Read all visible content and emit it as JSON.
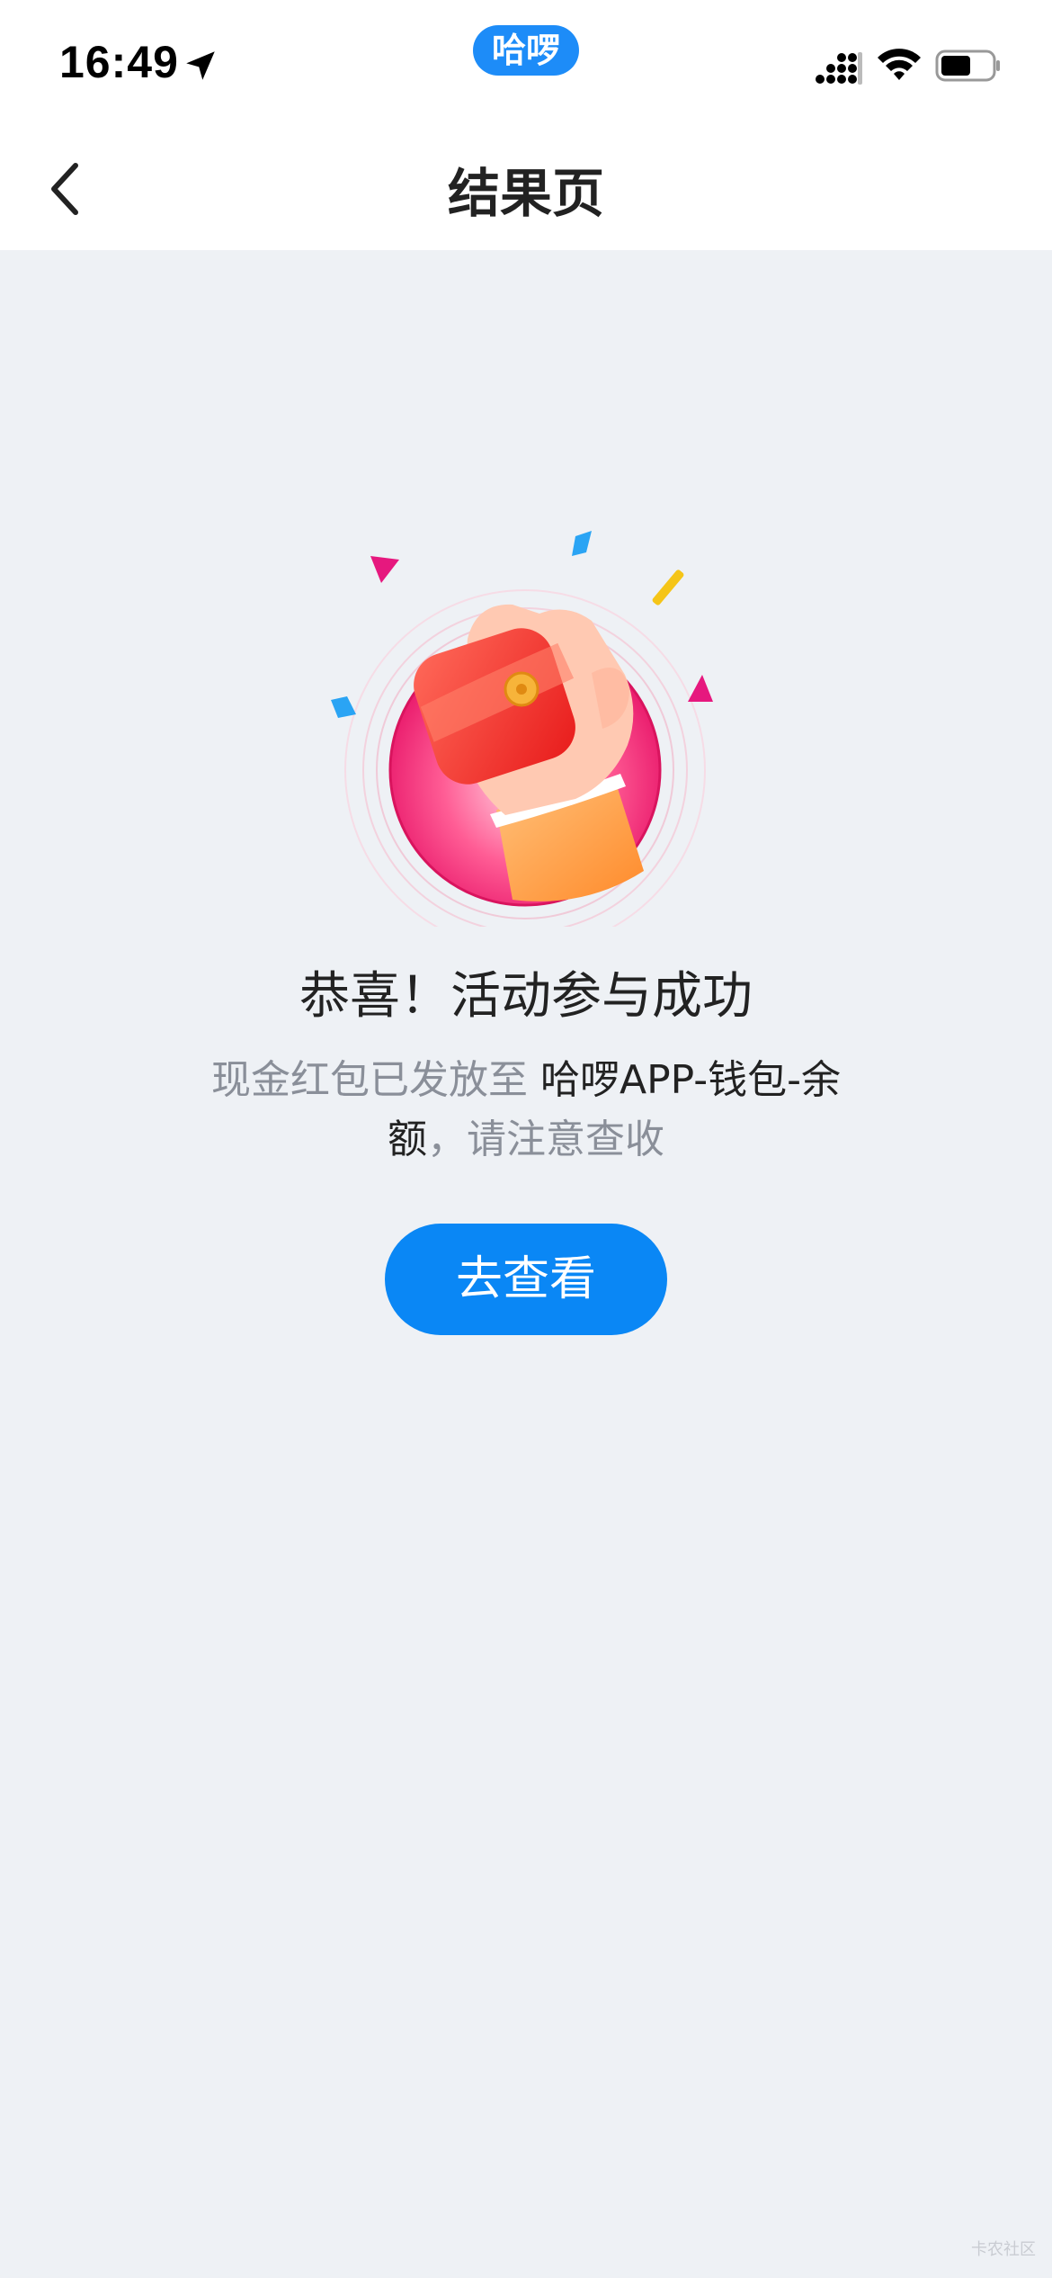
{
  "status_bar": {
    "time": "16:49",
    "app_badge": "哈啰"
  },
  "nav": {
    "title": "结果页"
  },
  "result": {
    "title": "恭喜！活动参与成功",
    "desc_prefix": "现金红包已发放至 ",
    "desc_highlight": "哈啰APP-钱包-余额",
    "desc_suffix": "，请注意查收"
  },
  "action": {
    "button_label": "去查看"
  },
  "watermark": "卡农社区",
  "colors": {
    "accent": "#0a87f5",
    "background": "#eef1f5",
    "confetti_pink": "#e6187e",
    "confetti_blue": "#2aa4f4",
    "confetti_yellow": "#f5c518"
  },
  "icons": [
    "location-arrow-icon",
    "cellular-signal-icon",
    "wifi-icon",
    "battery-icon",
    "back-chevron-icon",
    "red-envelope-hand-illustration"
  ]
}
